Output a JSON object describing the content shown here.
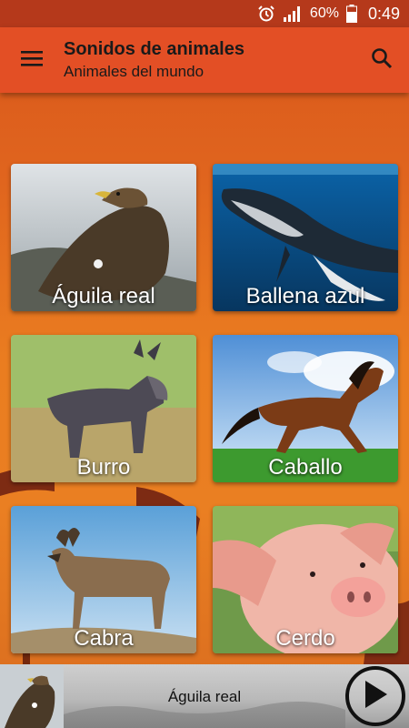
{
  "status_bar": {
    "alarm_icon": "alarm-icon",
    "signal_icon": "signal-icon",
    "battery_percent": "60%",
    "battery_level": 0.6,
    "time": "0:49"
  },
  "app_bar": {
    "title": "Sonidos de animales",
    "subtitle": "Animales del mundo",
    "menu_icon": "menu-icon",
    "search_icon": "search-icon"
  },
  "animals": [
    {
      "name": "Águila real"
    },
    {
      "name": "Ballena azul"
    },
    {
      "name": "Burro"
    },
    {
      "name": "Caballo"
    },
    {
      "name": "Cabra"
    },
    {
      "name": "Cerdo"
    }
  ],
  "player": {
    "now_playing": "Águila real",
    "play_icon": "play-icon"
  },
  "colors": {
    "status_bar": "#b5391b",
    "app_bar": "#e34f25",
    "background": "#e0651e"
  }
}
